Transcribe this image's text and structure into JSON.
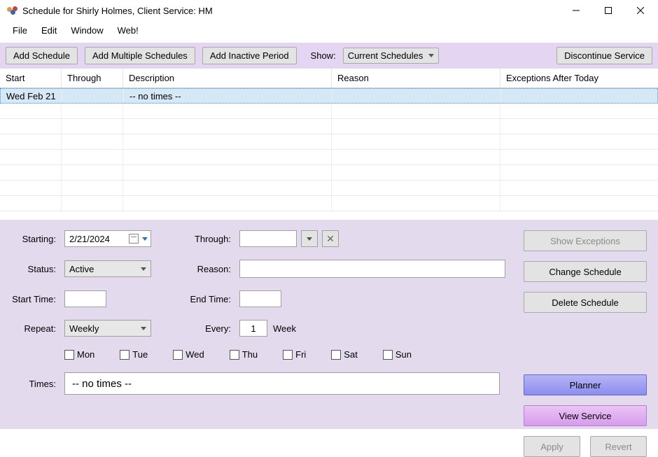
{
  "window": {
    "title": "Schedule for Shirly Holmes, Client Service: HM"
  },
  "menubar": [
    "File",
    "Edit",
    "Window",
    "Web!"
  ],
  "toolbar": {
    "add_schedule": "Add Schedule",
    "add_multiple": "Add Multiple Schedules",
    "add_inactive": "Add Inactive Period",
    "show_label": "Show:",
    "show_value": "Current Schedules",
    "discontinue": "Discontinue Service"
  },
  "grid": {
    "headers": {
      "start": "Start",
      "through": "Through",
      "description": "Description",
      "reason": "Reason",
      "exceptions": "Exceptions After Today"
    },
    "rows": [
      {
        "start": "Wed Feb 21",
        "through": "",
        "description": "-- no times --",
        "reason": "",
        "exceptions": ""
      }
    ]
  },
  "form": {
    "labels": {
      "starting": "Starting:",
      "through": "Through:",
      "status": "Status:",
      "reason": "Reason:",
      "start_time": "Start Time:",
      "end_time": "End Time:",
      "repeat": "Repeat:",
      "every": "Every:",
      "week": "Week",
      "times": "Times:"
    },
    "values": {
      "starting": "2/21/2024",
      "through": "",
      "status": "Active",
      "reason": "",
      "start_time": "",
      "end_time": "",
      "repeat": "Weekly",
      "every": "1",
      "times": "-- no times --"
    },
    "days": [
      "Mon",
      "Tue",
      "Wed",
      "Thu",
      "Fri",
      "Sat",
      "Sun"
    ]
  },
  "side": {
    "show_exceptions": "Show Exceptions",
    "change_schedule": "Change Schedule",
    "delete_schedule": "Delete Schedule",
    "planner": "Planner",
    "view_service": "View Service",
    "apply": "Apply",
    "revert": "Revert"
  }
}
